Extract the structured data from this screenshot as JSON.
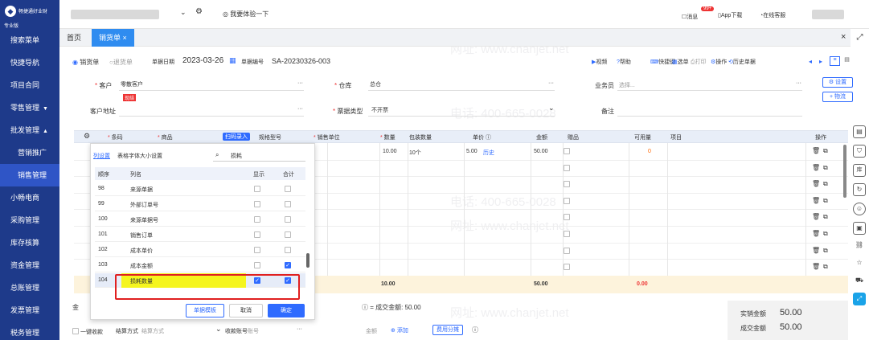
{
  "brand": {
    "name": "畅捷通好业财",
    "edition": "专业版"
  },
  "topbar": {
    "trial": "我要体验一下",
    "messages": "消息",
    "message_count": "99+",
    "app_download": "App下载",
    "online_service": "在线客服"
  },
  "sidebar": [
    {
      "label": "搜索菜单"
    },
    {
      "label": "快捷导航"
    },
    {
      "label": "项目合同"
    },
    {
      "label": "零售管理",
      "caret": "▼"
    },
    {
      "label": "批发管理",
      "caret": "▲"
    },
    {
      "label": "营销推广",
      "sub": true
    },
    {
      "label": "销售管理",
      "sub": true
    },
    {
      "label": "小畅电商"
    },
    {
      "label": "采购管理"
    },
    {
      "label": "库存核算"
    },
    {
      "label": "资金管理"
    },
    {
      "label": "总账管理"
    },
    {
      "label": "发票管理"
    },
    {
      "label": "税务管理"
    }
  ],
  "tabs": {
    "home": "首页",
    "active": "销货单",
    "close": "×"
  },
  "form": {
    "radio_sale": "销货单",
    "radio_return": "退货单",
    "date_label": "单据日期",
    "date_value": "2023-03-26",
    "no_label": "单据编号",
    "no_value": "SA-20230326-003",
    "toolbar": [
      "视频",
      "帮助",
      "快捷键",
      "选单",
      "打印",
      "操作",
      "历史单据"
    ],
    "customer_label": "客户",
    "customer_value": "零散客户",
    "customer_tag": "现结",
    "warehouse_label": "仓库",
    "warehouse_value": "总仓",
    "salesman_label": "业务员",
    "salesman_placeholder": "选择...",
    "settings_btn": "设置",
    "logistics_btn": "物流",
    "address_label": "客户地址",
    "invoice_label": "票据类型",
    "invoice_value": "不开票",
    "remark_label": "备注"
  },
  "grid": {
    "headers": [
      "条码",
      "商品",
      "扫码录入",
      "规格型号",
      "销售单位",
      "数量",
      "包装数量",
      "单价",
      "金额",
      "赠品",
      "可用量",
      "项目",
      "操作"
    ],
    "row1": {
      "qty": "10.00",
      "pack": "10个",
      "price": "5.00",
      "history": "历史",
      "amount": "50.00",
      "avail": "0"
    },
    "sum": {
      "qty": "10.00",
      "amount": "50.00",
      "avail": "0.00"
    }
  },
  "popup": {
    "tab1": "列设置",
    "tab2": "表格字体大小设置",
    "search": "损耗",
    "headers": [
      "顺序",
      "列名",
      "显示",
      "合计"
    ],
    "rows": [
      {
        "no": "98",
        "name": "来源单据",
        "show": false,
        "sum": false
      },
      {
        "no": "99",
        "name": "外部订单号",
        "show": false,
        "sum": false
      },
      {
        "no": "100",
        "name": "来源单据号",
        "show": false,
        "sum": false
      },
      {
        "no": "101",
        "name": "销售订单",
        "show": false,
        "sum": false
      },
      {
        "no": "102",
        "name": "成本单价",
        "show": false,
        "sum": false
      },
      {
        "no": "103",
        "name": "成本金额",
        "show": false,
        "sum": true
      },
      {
        "no": "104",
        "name": "损耗数量",
        "show": true,
        "sum": true
      }
    ],
    "btn_template": "单据模板",
    "btn_cancel": "取消",
    "btn_ok": "确定"
  },
  "footer": {
    "deal_label": "成交金额:",
    "deal_value": "50.00",
    "one_key": "一键收款",
    "settle_label": "结算方式",
    "settle_placeholder": "结算方式",
    "account_label": "收款账号",
    "account_placeholder": "账号",
    "amount_label": "金额",
    "add": "添加",
    "split": "费用分摊",
    "actual_label": "实销金额",
    "actual_value": "50.00",
    "deal_label2": "成交金额",
    "deal_value2": "50.00",
    "partial_label": "金"
  },
  "watermark": {
    "phone": "电话: 400-665-0028",
    "site": "网址: www.chanjet.net"
  }
}
